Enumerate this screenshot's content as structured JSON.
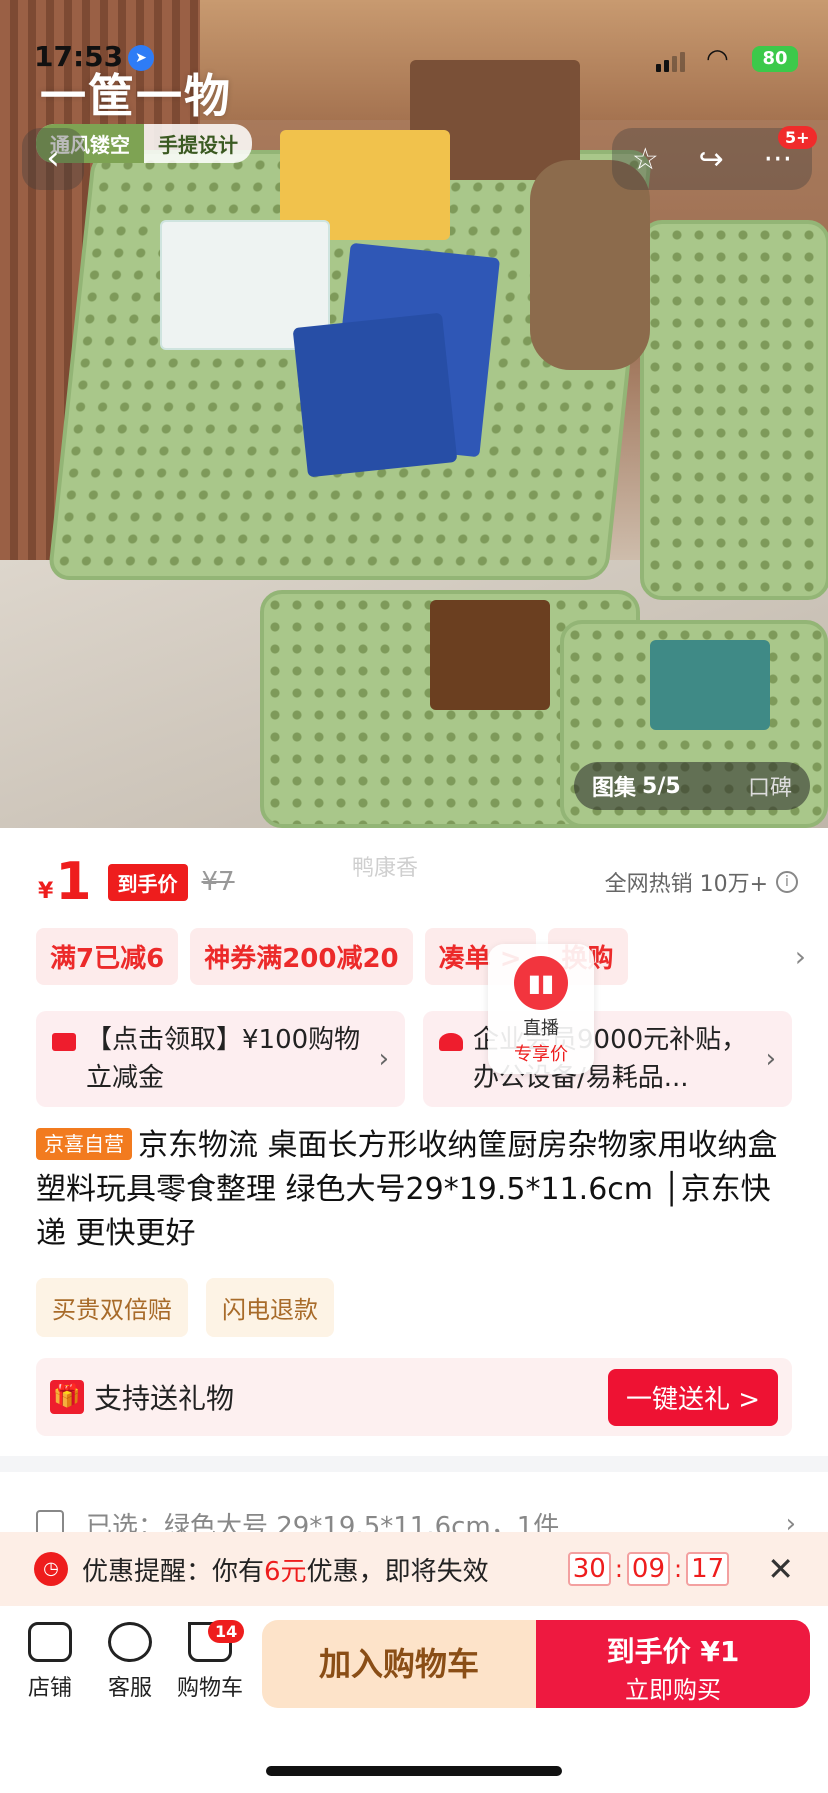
{
  "status_bar": {
    "time": "17:53",
    "battery": "80"
  },
  "hero": {
    "title": "一筐一物",
    "tag_1": "通风镂空",
    "tag_2": "手提设计",
    "nav_badge": "5+",
    "gallery_label": "图集",
    "gallery_index": "5/5",
    "reviews_label": "口碑"
  },
  "watermark": "鸭康香",
  "price": {
    "symbol": "¥",
    "value": "1",
    "badge": "到手价",
    "original": "¥7",
    "sales": "全网热销 10万+"
  },
  "promos": [
    "满7已减6",
    "神券满200减20",
    "凑单 >",
    "换购"
  ],
  "coupons": [
    {
      "text": "【点击领取】¥100购物立减金"
    },
    {
      "text": "企业会员9000元补贴，办公设备/易耗品..."
    }
  ],
  "live_float": {
    "line1": "直播",
    "line2": "专享价"
  },
  "product": {
    "badge": "京喜自营",
    "title": "京东物流 桌面长方形收纳筐厨房杂物家用收纳盒塑料玩具零食整理 绿色大号29*19.5*11.6cm │京东快递 更快更好"
  },
  "guarantees": [
    "买贵双倍赔",
    "闪电退款"
  ],
  "gift": {
    "label": "支持送礼物",
    "button": "一键送礼 >"
  },
  "selected": {
    "text": "已选：绿色大号 29*19.5*11.6cm，1件"
  },
  "reminder": {
    "prefix": "优惠提醒：你有",
    "amount": "6元",
    "suffix": "优惠，即将失效",
    "timer": [
      "30",
      "09",
      "17"
    ]
  },
  "bottom_nav": {
    "shop": "店铺",
    "service": "客服",
    "cart": "购物车",
    "cart_badge": "14",
    "add_to_cart": "加入购物车",
    "buy_price": "到手价 ¥1",
    "buy_now": "立即购买"
  }
}
